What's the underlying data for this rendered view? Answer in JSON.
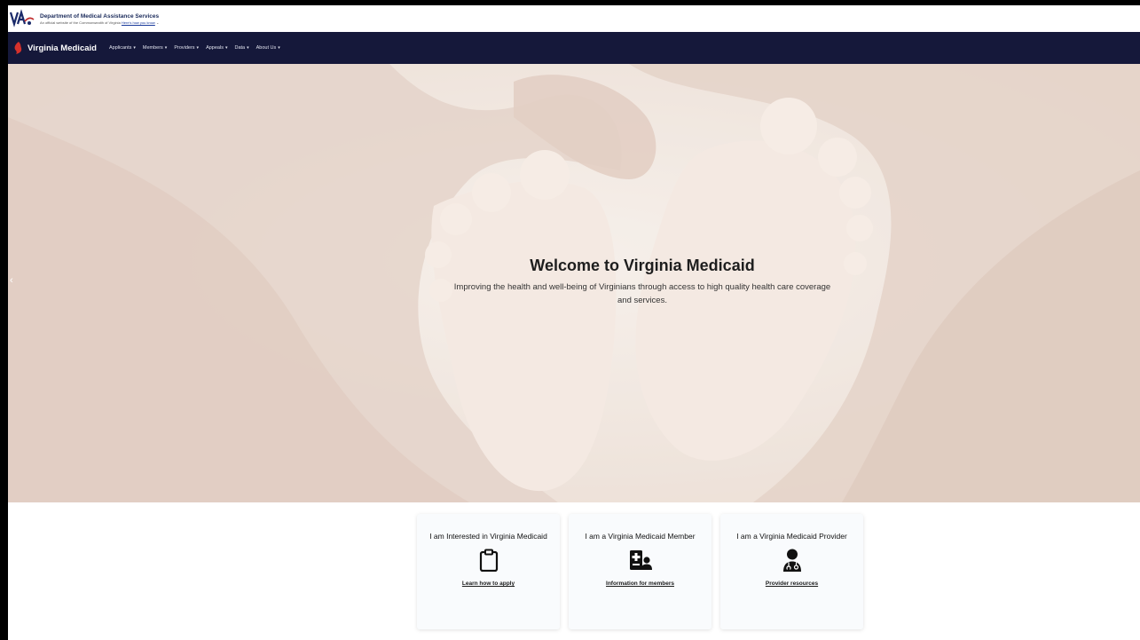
{
  "gov_banner": {
    "title": "Department of Medical Assistance Services",
    "subtitle": "An official website of the Commonwealth of Virginia",
    "subtitle_link": "Here's how you know"
  },
  "navbar": {
    "brand": "Virginia Medicaid",
    "items": [
      {
        "label": "Applicants"
      },
      {
        "label": "Members"
      },
      {
        "label": "Providers"
      },
      {
        "label": "Appeals"
      },
      {
        "label": "Data"
      },
      {
        "label": "About Us"
      }
    ]
  },
  "hero": {
    "title": "Welcome to Virginia Medicaid",
    "description": "Improving the health and well-being of Virginians through access to high quality health care coverage and services."
  },
  "cards": [
    {
      "title": "I am Interested in Virginia Medicaid",
      "icon": "clipboard-icon",
      "link": "Learn how to apply"
    },
    {
      "title": "I am a Virginia Medicaid Member",
      "icon": "member-card-icon",
      "link": "Information for members"
    },
    {
      "title": "I am a Virginia Medicaid Provider",
      "icon": "doctor-icon",
      "link": "Provider resources"
    }
  ],
  "colors": {
    "nav_bg": "#15183a",
    "brand_red": "#d6312b",
    "hero_bg": "#efe6df"
  }
}
